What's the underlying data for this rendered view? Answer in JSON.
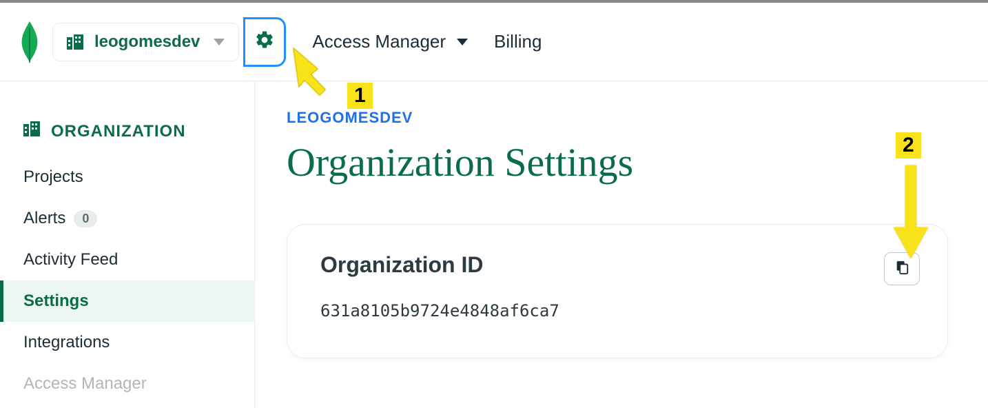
{
  "topbar": {
    "org_name": "leogomesdev",
    "nav": {
      "access_manager": "Access Manager",
      "billing": "Billing"
    }
  },
  "sidebar": {
    "header": "ORGANIZATION",
    "items": {
      "projects": "Projects",
      "alerts": "Alerts",
      "alerts_count": "0",
      "activity_feed": "Activity Feed",
      "settings": "Settings",
      "integrations": "Integrations",
      "access_manager": "Access Manager"
    }
  },
  "main": {
    "breadcrumb": "LEOGOMESDEV",
    "title": "Organization Settings",
    "card": {
      "title": "Organization ID",
      "value": "631a8105b9724e4848af6ca7"
    }
  },
  "annotations": {
    "one": "1",
    "two": "2"
  }
}
